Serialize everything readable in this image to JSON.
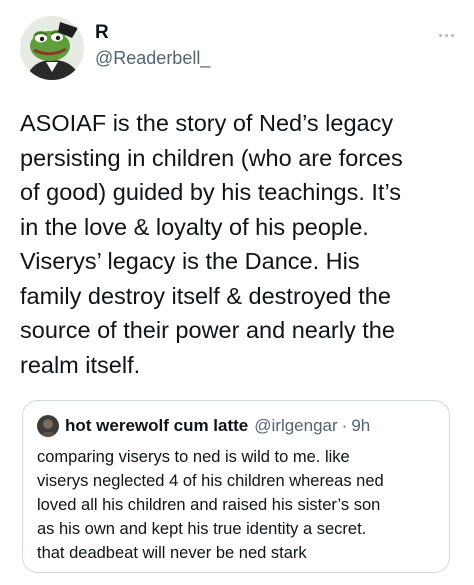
{
  "author": {
    "display_name": "R",
    "handle": "@Readerbell_",
    "avatar_icon": "frog-avatar-icon"
  },
  "tweet": {
    "text": "ASOIAF is the story of Ned’s legacy\npersisting in children (who are forces\nof good) guided by his teachings. It’s\nin the love & loyalty of his people.\nViserys’ legacy is the Dance. His\nfamily destroy itself & destroyed the\nsource of their power and nearly the\nrealm itself."
  },
  "more_icon": "more-options-icon",
  "quote": {
    "display_name": "hot werewolf cum latte",
    "handle": "@irlgengar",
    "separator": "·",
    "time": "9h",
    "avatar_icon": "user-avatar-icon",
    "text": "comparing viserys to ned is wild to me. like\nviserys neglected 4 of his children whereas ned\nloved all his children and raised his sister’s son\nas his own and kept his true identity a secret.\nthat deadbeat will never be ned stark"
  },
  "colors": {
    "text_primary": "#0f1419",
    "text_secondary": "#536471",
    "border": "#cfd9de"
  }
}
